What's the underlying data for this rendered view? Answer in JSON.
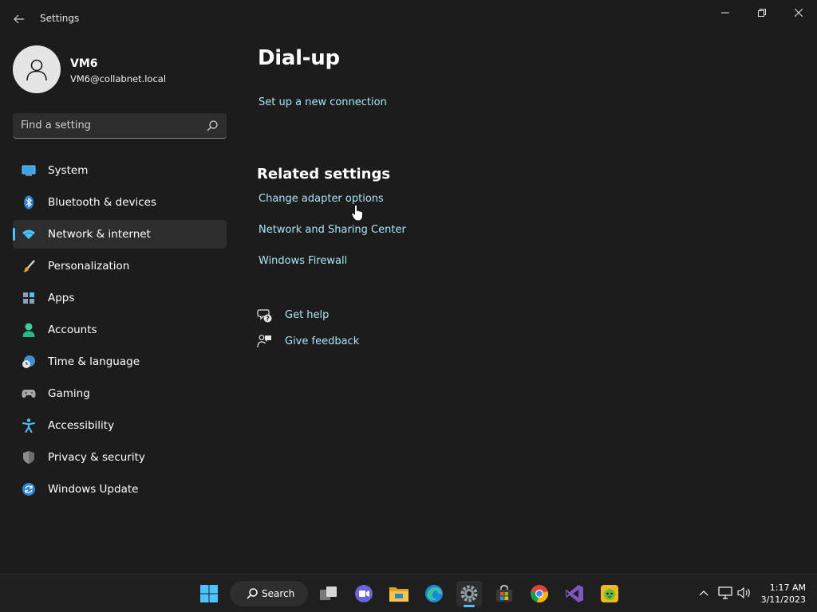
{
  "window": {
    "title": "Settings",
    "back_icon": "back-arrow-icon",
    "controls": [
      "minimize-icon",
      "restore-icon",
      "close-icon"
    ]
  },
  "profile": {
    "name": "VM6",
    "email": "VM6@collabnet.local"
  },
  "search": {
    "placeholder": "Find a setting",
    "value": ""
  },
  "sidebar": {
    "items": [
      {
        "label": "System",
        "icon": "system-icon",
        "active": false
      },
      {
        "label": "Bluetooth & devices",
        "icon": "bluetooth-icon",
        "active": false
      },
      {
        "label": "Network & internet",
        "icon": "wifi-icon",
        "active": true
      },
      {
        "label": "Personalization",
        "icon": "brush-icon",
        "active": false
      },
      {
        "label": "Apps",
        "icon": "apps-icon",
        "active": false
      },
      {
        "label": "Accounts",
        "icon": "accounts-icon",
        "active": false
      },
      {
        "label": "Time & language",
        "icon": "clock-globe-icon",
        "active": false
      },
      {
        "label": "Gaming",
        "icon": "gamepad-icon",
        "active": false
      },
      {
        "label": "Accessibility",
        "icon": "accessibility-icon",
        "active": false
      },
      {
        "label": "Privacy & security",
        "icon": "shield-icon",
        "active": false
      },
      {
        "label": "Windows Update",
        "icon": "update-icon",
        "active": false
      }
    ]
  },
  "main": {
    "title": "Dial-up",
    "setup_link": "Set up a new connection",
    "related_title": "Related settings",
    "related_links": [
      "Change adapter options",
      "Network and Sharing Center",
      "Windows Firewall"
    ],
    "help_links": [
      {
        "label": "Get help",
        "icon": "help-chat-icon"
      },
      {
        "label": "Give feedback",
        "icon": "feedback-icon"
      }
    ]
  },
  "taskbar": {
    "search_label": "Search",
    "apps": [
      "start-icon",
      "task-view-icon",
      "chat-icon",
      "file-explorer-icon",
      "edge-icon",
      "settings-icon",
      "store-icon",
      "chrome-icon",
      "visual-studio-icon",
      "game-icon"
    ],
    "active_app": "settings-icon",
    "tray": [
      "chevron-up-icon",
      "network-icon",
      "volume-icon"
    ],
    "time": "1:17 AM",
    "date": "3/11/2023"
  },
  "colors": {
    "background": "#1c1c1c",
    "accent": "#4cc2ff",
    "link": "#a8e5f7"
  }
}
